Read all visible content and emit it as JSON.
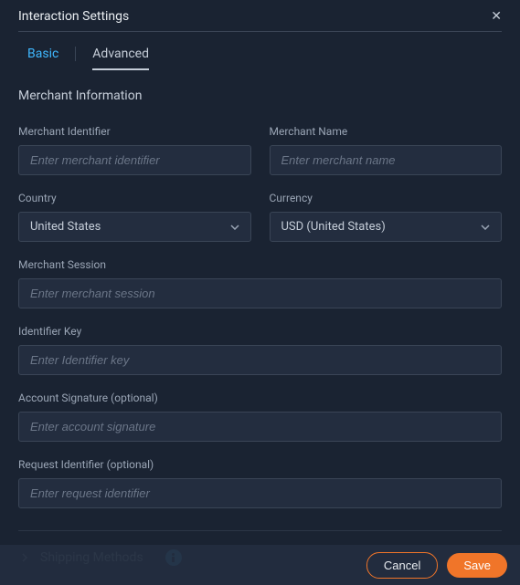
{
  "modal": {
    "title": "Interaction Settings"
  },
  "tabs": {
    "basic": "Basic",
    "advanced": "Advanced"
  },
  "section": {
    "merchant_info": "Merchant Information",
    "shipping_methods": "Shipping Methods"
  },
  "fields": {
    "merchant_identifier": {
      "label": "Merchant Identifier",
      "placeholder": "Enter merchant identifier"
    },
    "merchant_name": {
      "label": "Merchant Name",
      "placeholder": "Enter merchant name"
    },
    "country": {
      "label": "Country",
      "value": "United States"
    },
    "currency": {
      "label": "Currency",
      "value": "USD (United States)"
    },
    "merchant_session": {
      "label": "Merchant Session",
      "placeholder": "Enter merchant session"
    },
    "identifier_key": {
      "label": "Identifier Key",
      "placeholder": "Enter Identifier key"
    },
    "account_signature": {
      "label": "Account Signature (optional)",
      "placeholder": "Enter account signature"
    },
    "request_identifier": {
      "label": "Request Identifier (optional)",
      "placeholder": "Enter request identifier"
    }
  },
  "buttons": {
    "cancel": "Cancel",
    "save": "Save"
  }
}
